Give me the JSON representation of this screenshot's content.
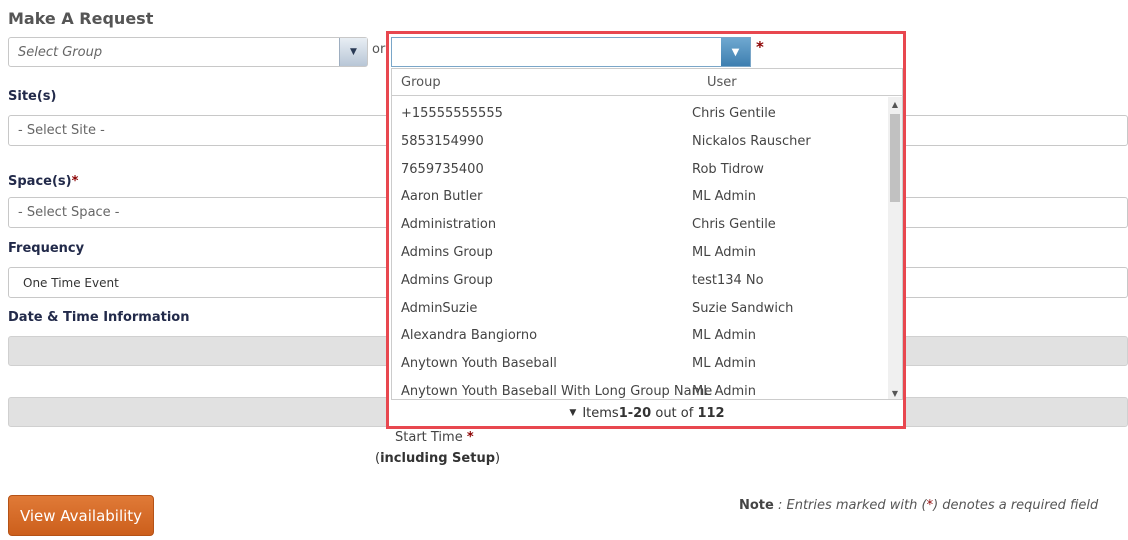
{
  "title": "Make A Request",
  "group_select": {
    "placeholder": "Select Group"
  },
  "or_text": "or",
  "required_star": "*",
  "sites": {
    "label": "Site(s)",
    "placeholder": "- Select Site -"
  },
  "spaces": {
    "label": "Space(s)",
    "placeholder": "- Select Space -"
  },
  "frequency": {
    "label": "Frequency",
    "value": "One Time Event"
  },
  "datetime": {
    "label": "Date & Time Information"
  },
  "start_time": {
    "label": "Start Time",
    "sub_open": "(",
    "sub_bold": "including Setup",
    "sub_close": ")"
  },
  "view_availability": "View Availability",
  "note": {
    "bold": "Note",
    "text_before": " : Entries marked with (",
    "star": "*",
    "text_after": ") denotes a required field"
  },
  "dropdown": {
    "value": "",
    "columns": [
      "Group",
      "User"
    ],
    "rows": [
      {
        "group": "+15555555555",
        "user": "Chris Gentile"
      },
      {
        "group": "5853154990",
        "user": "Nickalos Rauscher"
      },
      {
        "group": "7659735400",
        "user": "Rob Tidrow"
      },
      {
        "group": "Aaron Butler",
        "user": "ML Admin"
      },
      {
        "group": "Administration",
        "user": "Chris Gentile"
      },
      {
        "group": "Admins Group",
        "user": "ML Admin"
      },
      {
        "group": "Admins Group",
        "user": "test134 No"
      },
      {
        "group": "AdminSuzie",
        "user": "Suzie Sandwich"
      },
      {
        "group": "Alexandra Bangiorno",
        "user": "ML Admin"
      },
      {
        "group": "Anytown Youth Baseball",
        "user": "ML Admin"
      },
      {
        "group": "Anytown Youth Baseball With Long Group Name",
        "user": "ML Admin"
      }
    ],
    "footer": {
      "prefix": "Items ",
      "range": "1-20",
      "middle": " out of ",
      "total": "112"
    }
  },
  "colors": {
    "highlight_border": "#e8474f",
    "button_orange": "#d9682a",
    "required": "#8b0000"
  }
}
